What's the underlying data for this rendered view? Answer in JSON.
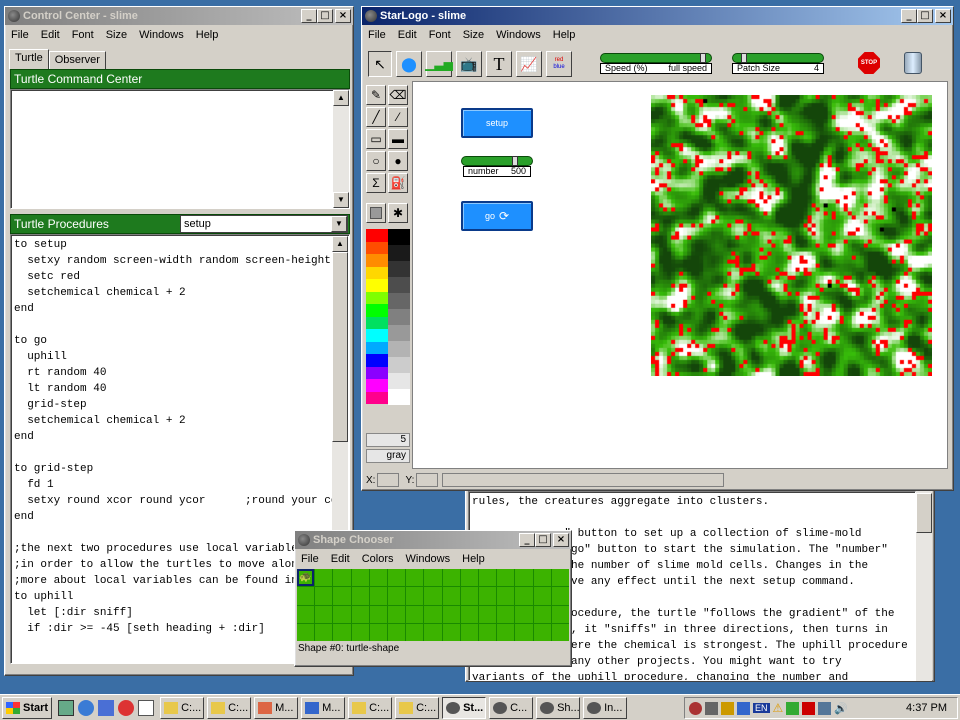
{
  "control_center": {
    "title": "Control Center - slime",
    "menu": [
      "File",
      "Edit",
      "Font",
      "Size",
      "Windows",
      "Help"
    ],
    "tabs": [
      "Turtle",
      "Observer"
    ],
    "command_center_label": "Turtle Command Center",
    "procedures_label": "Turtle Procedures",
    "procedure_select": "setup",
    "code": "to setup\n  setxy random screen-width random screen-height\n  setc red\n  setchemical chemical + 2\nend\n\nto go\n  uphill\n  rt random 40\n  lt random 40\n  grid-step\n  setchemical chemical + 2\nend\n\nto grid-step\n  fd 1\n  setxy round xcor round ycor      ;round your co\nend\n\n;the next two procedures use local variable\n;in order to allow the turtles to move alon\n;more about local variables can be found in\nto uphill\n  let [:dir sniff]\n  if :dir >= -45 [seth heading + :dir]"
  },
  "starlogo": {
    "title": "StarLogo - slime",
    "menu": [
      "File",
      "Edit",
      "Font",
      "Size",
      "Windows",
      "Help"
    ],
    "speed_label": "Speed (%)",
    "speed_value": "full speed",
    "speed_level": 0.95,
    "patch_label": "Patch Size",
    "patch_value": "4",
    "patch_level": 0.1,
    "stop_label": "STOP",
    "setup_button": "setup",
    "number_label": "number",
    "number_value": "500",
    "number_level": 0.78,
    "go_button": "go",
    "color_value": "5",
    "color_name": "gray",
    "x_label": "X:",
    "y_label": "Y:",
    "legend_red": "red",
    "legend_blue": "blue"
  },
  "info_text": "rules, the creatures aggregate into clusters.\n\n              \" button to set up a collection of slime-mold\n              \"go\" button to start the simulation. The \"number\"\n              the number of slime mold cells. Changes in the\n              ave any effect until the next setup command.\n\n              rocedure, the turtle \"follows the gradient\" of the\n              s, it \"sniffs\" in three directions, then turns in\n              here the chemical is strongest. The uphill procedure\n              many other projects. You might want to try\nvariants of the uphill procedure, changing the number and",
  "shape_chooser": {
    "title": "Shape Chooser",
    "menu": [
      "File",
      "Edit",
      "Colors",
      "Windows",
      "Help"
    ],
    "status": "Shape #0: turtle-shape"
  },
  "taskbar": {
    "start": "Start",
    "items": [
      "C:...",
      "C:...",
      "M...",
      "M...",
      "C:...",
      "C:...",
      "St...",
      "C...",
      "Sh...",
      "In..."
    ],
    "clock": "4:37 PM",
    "lang": "EN"
  },
  "colors": {
    "title_active": "#0a246a",
    "green_panel": "#1e7a1e",
    "button_blue": "#1e90ff"
  }
}
